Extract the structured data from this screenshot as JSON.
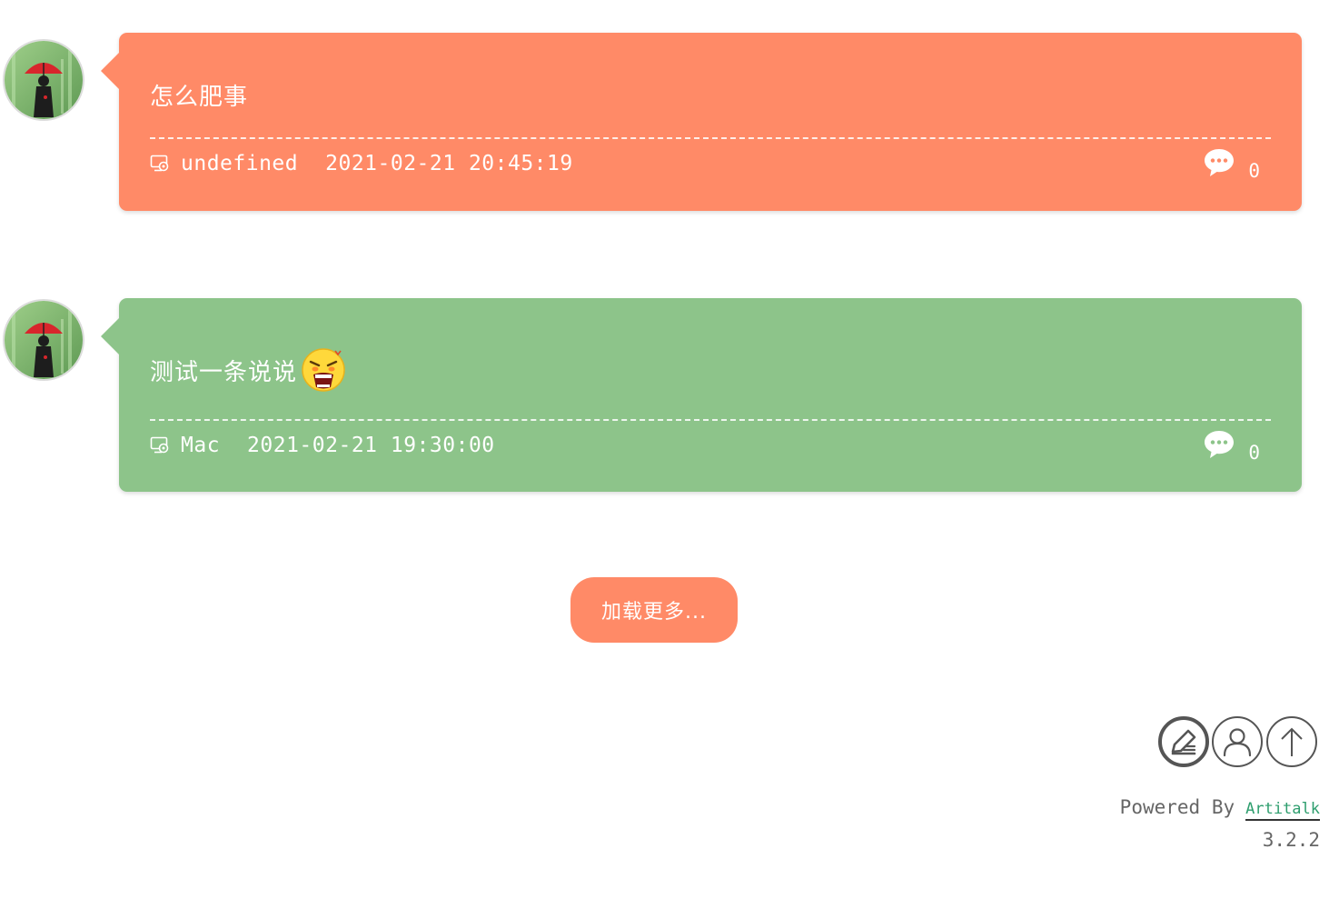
{
  "posts": [
    {
      "text": "怎么肥事",
      "device": "undefined",
      "datetime": "2021-02-21 20:45:19",
      "comment_count": "0",
      "card_color": "#ff8a67",
      "has_emoji": false
    },
    {
      "text": "测试一条说说",
      "device": "Mac",
      "datetime": "2021-02-21 19:30:00",
      "comment_count": "0",
      "card_color": "#8dc48a",
      "has_emoji": true,
      "emoji_icon": "angry-shouting-emoji-icon"
    }
  ],
  "load_more": {
    "label": "加载更多...",
    "color": "#ff8a67"
  },
  "toolbar": {
    "icons": [
      "edit-icon",
      "user-icon",
      "arrow-up-icon"
    ]
  },
  "footer": {
    "powered_by": "Powered By",
    "link_text": "Artitalk",
    "version": "3.2.2"
  }
}
